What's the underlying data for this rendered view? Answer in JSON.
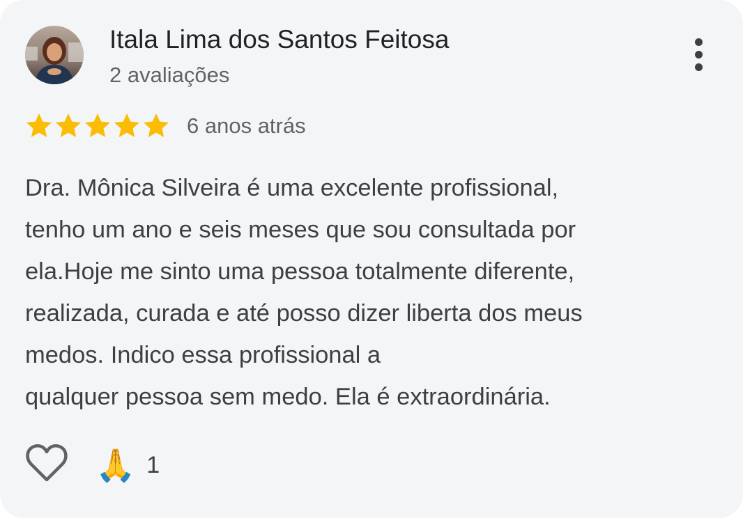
{
  "review": {
    "author_name": "Itala Lima dos Santos Feitosa",
    "review_count": "2 avaliações",
    "rating": 5,
    "rating_max": 5,
    "date": "6 anos atrás",
    "text_lines": [
      "Dra. Mônica Silveira é uma excelente profissional,",
      "tenho um ano e seis meses que sou consultada por",
      "ela.Hoje me sinto uma pessoa totalmente diferente,",
      "realizada, curada e até posso dizer liberta dos meus",
      "medos. Indico essa profissional a",
      "qualquer pessoa sem medo. Ela é extraordinária."
    ]
  },
  "reactions": {
    "like_icon": "heart-outline-icon",
    "emoji": "🙏",
    "emoji_icon": "folded-hands-icon",
    "count": "1"
  },
  "menu": {
    "icon": "more-vertical-icon"
  },
  "colors": {
    "card_background": "#f4f5f7",
    "star": "#fbbc04",
    "name": "#202124",
    "secondary_text": "#5f6368",
    "body_text": "#3c4043"
  }
}
